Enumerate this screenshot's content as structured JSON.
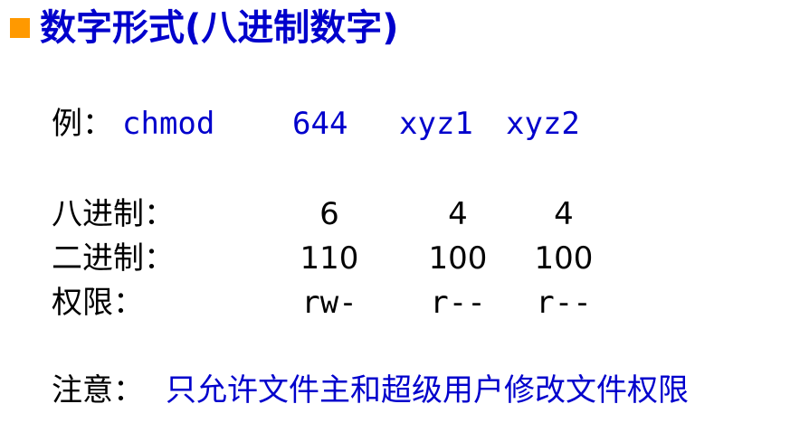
{
  "title": "数字形式(八进制数字)",
  "example": {
    "label": "例：",
    "command": "chmod",
    "mode": "644",
    "file1": "xyz1",
    "file2": "xyz2"
  },
  "rows": [
    {
      "label": "八进制：",
      "values": [
        "6",
        "4",
        "4"
      ]
    },
    {
      "label": "二进制：",
      "values": [
        "110",
        "100",
        "100"
      ]
    },
    {
      "label": "权限：",
      "values": [
        "rw-",
        "r--",
        "r--"
      ]
    }
  ],
  "note": {
    "label": "注意：",
    "text": "只允许文件主和超级用户修改文件权限"
  },
  "colors": {
    "accent_blue": "#0000CC",
    "bullet_orange": "#FF9900",
    "text_black": "#000000"
  }
}
